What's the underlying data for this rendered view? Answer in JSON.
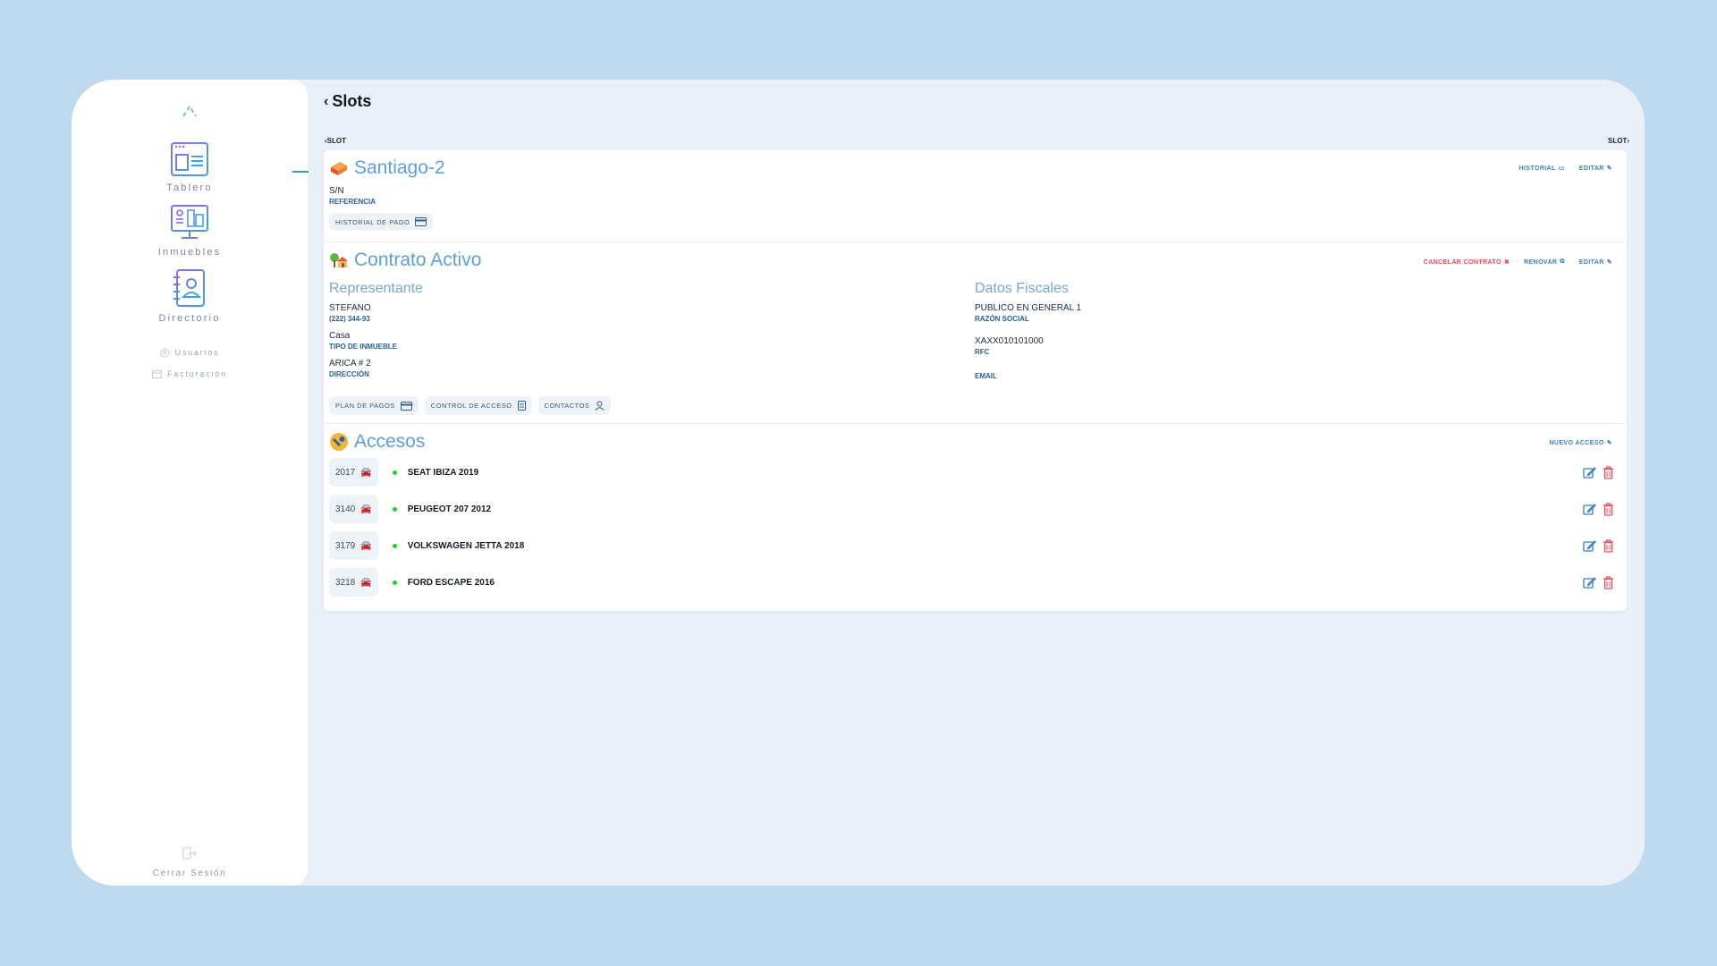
{
  "sidebar": {
    "items": [
      {
        "label": "Tablero",
        "icon": "dashboard-window-icon"
      },
      {
        "label": "Inmuebles",
        "icon": "buildings-monitor-icon"
      },
      {
        "label": "Directorio",
        "icon": "contact-book-icon"
      }
    ],
    "small_items": [
      {
        "label": "Usuarios",
        "icon": "users-icon"
      },
      {
        "label": "Facturación",
        "icon": "invoice-icon"
      }
    ],
    "logout_label": "Cerrar Sesión"
  },
  "header": {
    "title": "Slots",
    "prev_label": "SLOT",
    "next_label": "SLOT"
  },
  "slot": {
    "name": "Santiago-2",
    "reference_value": "S/N",
    "reference_label": "REFERENCIA",
    "payment_history_label": "HISTORIAL DE PAGO",
    "actions": {
      "history": "HISTORIAL",
      "edit": "EDITAR"
    }
  },
  "contract": {
    "title": "Contrato Activo",
    "actions": {
      "cancel": "CANCELAR CONTRATO",
      "renew": "RENOVAR",
      "edit": "EDITAR"
    },
    "representative": {
      "heading": "Representante",
      "name": "STEFANO",
      "phone": "(222) 344-93",
      "property_type_value": "Casa",
      "property_type_label": "TIPO DE INMUEBLE",
      "address_value": "ARICA # 2",
      "address_label": "DIRECCIÓN"
    },
    "fiscal": {
      "heading": "Datos Fiscales",
      "business_name_value": "PUBLICO EN GENERAL 1",
      "business_name_label": "RAZÓN SOCIAL",
      "rfc_value": "XAXX010101000",
      "rfc_label": "RFC",
      "email_value": "",
      "email_label": "EMAIL"
    },
    "buttons": {
      "payment_plan": "PLAN DE PAGOS",
      "access_control": "CONTROL DE ACCESO",
      "contacts": "CONTACTOS"
    }
  },
  "access": {
    "title": "Accesos",
    "new_label": "NUEVO ACCESO",
    "rows": [
      {
        "code": "2017",
        "vehicle": "SEAT IBIZA 2019",
        "status": "active"
      },
      {
        "code": "3140",
        "vehicle": "PEUGEOT 207 2012",
        "status": "active"
      },
      {
        "code": "3179",
        "vehicle": "VOLKSWAGEN JETTA 2018",
        "status": "active"
      },
      {
        "code": "3218",
        "vehicle": "FORD ESCAPE 2016",
        "status": "active"
      }
    ]
  },
  "colors": {
    "accent": "#5c9fd9",
    "danger": "#ee4a59",
    "active_dot": "#1fcf2a",
    "background": "#bfd9ee"
  }
}
